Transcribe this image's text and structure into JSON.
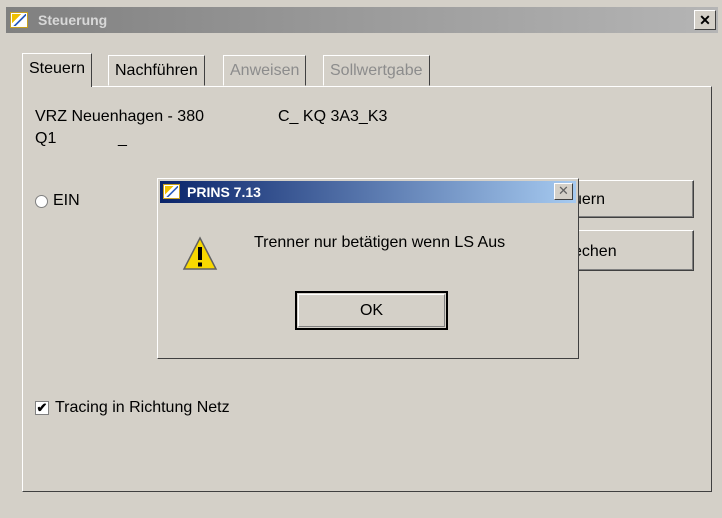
{
  "window": {
    "title": "Steuerung",
    "close_glyph": "✕"
  },
  "tabs": [
    {
      "label": "Steuern",
      "state": "active"
    },
    {
      "label": "Nachführen",
      "state": "enabled"
    },
    {
      "label": "Anweisen",
      "state": "disabled"
    },
    {
      "label": "Sollwertgabe",
      "state": "disabled"
    }
  ],
  "info": {
    "line1_a": "VRZ  Neuenhagen - 380",
    "line1_b": "C_  KQ  3A3_K3",
    "line2_a": "Q1",
    "line2_b": "_"
  },
  "radio": {
    "label": "EIN",
    "checked": false
  },
  "buttons": {
    "right1_label": "uern",
    "right2_label": "echen"
  },
  "checkbox": {
    "label": "Tracing in Richtung Netz",
    "checked": true,
    "mark": "✔"
  },
  "dialog": {
    "title": "PRINS 7.13",
    "close_glyph": "✕",
    "message": "Trenner nur betätigen wenn LS Aus",
    "ok_label": "OK",
    "icon": "warning-icon"
  },
  "colors": {
    "face": "#d4d0c8",
    "dialog_title_start": "#0a246a",
    "dialog_title_end": "#a6caf0",
    "inactive_title": "#808080"
  }
}
